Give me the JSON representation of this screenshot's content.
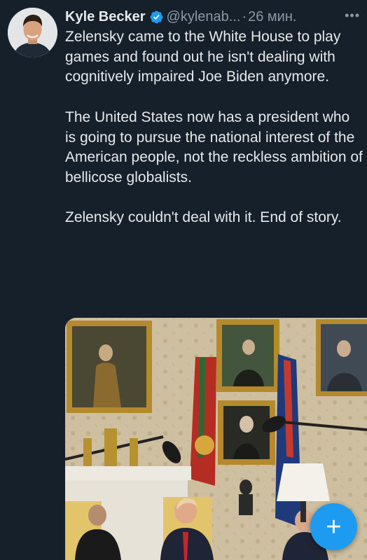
{
  "tweet": {
    "author_name": "Kyle Becker",
    "handle": "@kylenab...",
    "separator": "·",
    "time": "26 мин.",
    "more_icon": "more-horizontal-icon",
    "verified_icon": "verified-badge-icon",
    "verified_color": "#1d9bf0",
    "text_paragraphs": [
      "Zelensky came to the White House to play games and found out he isn't dealing with cognitively impaired Joe Biden anymore.",
      "The United States now has a president who is going to pursue the national interest of the American people, not the reckless ambition of bellicose globalists.",
      "Zelensky couldn't deal with it. End of story."
    ]
  },
  "fab": {
    "label": "+",
    "icon": "compose-plus-icon",
    "color": "#1d9bf0"
  },
  "theme": {
    "background": "#15202b",
    "text": "#e7e9ea",
    "secondary_text": "#8b98a5"
  }
}
